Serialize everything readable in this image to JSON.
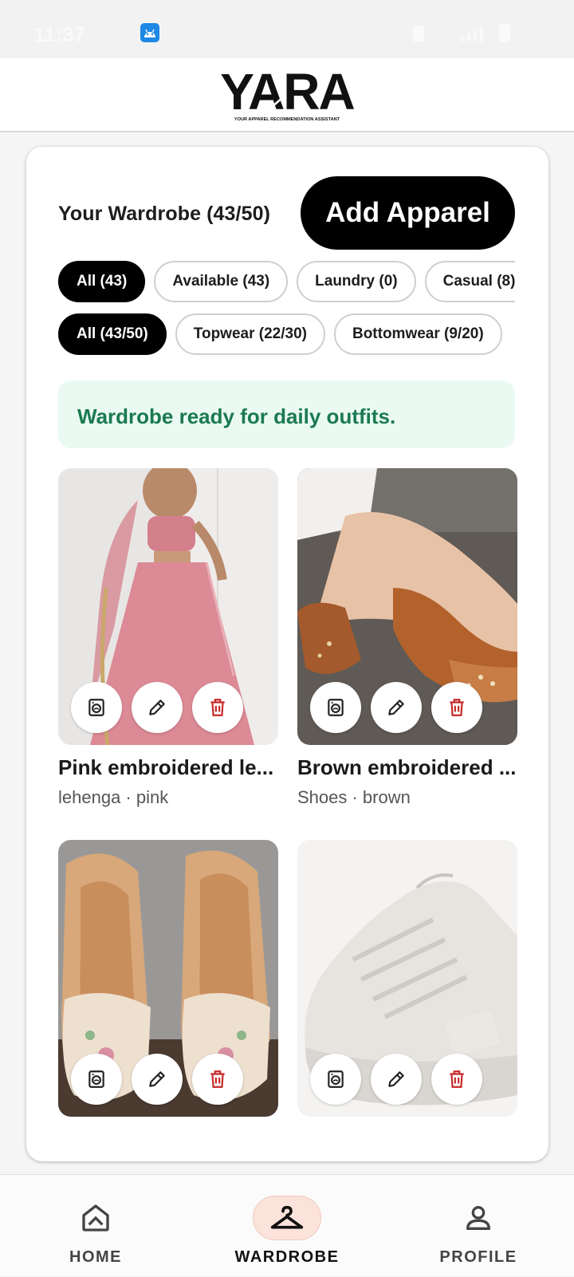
{
  "status_bar": {
    "time": "11:37",
    "app_icon": "android-icon"
  },
  "header": {
    "logo_text": "YARA",
    "logo_tagline": "YOUR APPAREL RECOMMENDATION ASSISTANT"
  },
  "wardrobe": {
    "title": "Your Wardrobe (43/50)",
    "add_button_label": "Add Apparel",
    "status_chips": [
      {
        "label": "All (43)",
        "active": true
      },
      {
        "label": "Available (43)",
        "active": false
      },
      {
        "label": "Laundry (0)",
        "active": false
      },
      {
        "label": "Casual (8)",
        "active": false
      }
    ],
    "category_chips": [
      {
        "label": "All (43/50)",
        "active": true
      },
      {
        "label": "Topwear (22/30)",
        "active": false
      },
      {
        "label": "Bottomwear (9/20)",
        "active": false
      }
    ],
    "banner_text": "Wardrobe ready for daily outfits.",
    "items": [
      {
        "name": "Pink embroidered le...",
        "meta": "lehenga · pink",
        "image": "pink-lehenga-photo"
      },
      {
        "name": "Brown embroidered ...",
        "meta": "Shoes · brown",
        "image": "brown-juttis-photo"
      },
      {
        "name": "",
        "meta": "",
        "image": "beige-embroidered-juttis-photo"
      },
      {
        "name": "",
        "meta": "",
        "image": "white-sneakers-photo"
      }
    ],
    "item_actions": [
      "laundry-icon",
      "edit-icon",
      "delete-icon"
    ]
  },
  "bottom_nav": {
    "items": [
      {
        "label": "HOME",
        "icon": "home-icon",
        "active": false
      },
      {
        "label": "WARDROBE",
        "icon": "hanger-icon",
        "active": true
      },
      {
        "label": "PROFILE",
        "icon": "person-icon",
        "active": false
      }
    ]
  },
  "colors": {
    "accent_black": "#000000",
    "banner_bg": "#eafaf2",
    "banner_text": "#1b7a50",
    "delete_red": "#c62828",
    "nav_active_bg": "#fbe3dc"
  }
}
